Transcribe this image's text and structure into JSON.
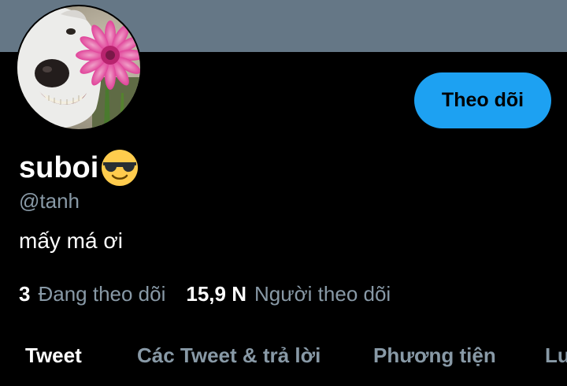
{
  "profile": {
    "display_name": "suboi",
    "handle": "@tanh",
    "bio": "mấy má ơi",
    "follow_button_label": "Theo dõi",
    "name_emoji": "smiling-face-with-sunglasses-icon"
  },
  "stats": {
    "following_count": "3",
    "following_label": "Đang theo dõi",
    "followers_count": "15,9 N",
    "followers_label": "Người theo dõi"
  },
  "tabs": [
    {
      "label": "Tweet",
      "active": true
    },
    {
      "label": "Các Tweet & trả lời",
      "active": false
    },
    {
      "label": "Phương tiện",
      "active": false
    },
    {
      "label": "Lu",
      "active": false
    }
  ],
  "colors": {
    "banner": "#657786",
    "accent": "#1da1f2",
    "background": "#000000",
    "secondary_text": "#8899a6"
  }
}
